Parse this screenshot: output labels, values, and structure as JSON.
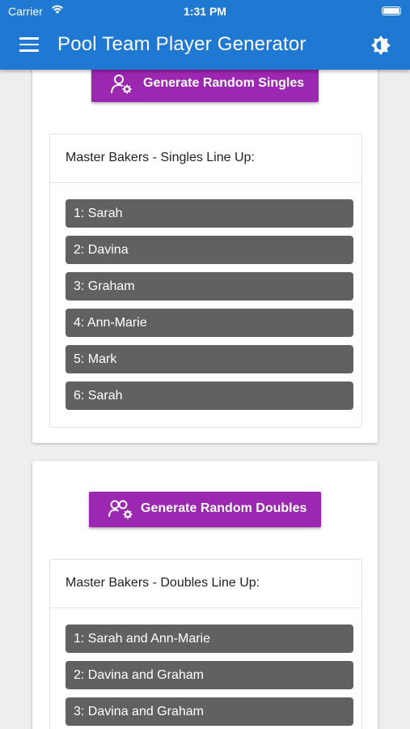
{
  "status": {
    "carrier": "Carrier",
    "time": "1:31 PM"
  },
  "appbar": {
    "title": "Pool Team Player Generator"
  },
  "singles": {
    "button_label": "Generate Random Singles",
    "panel_title": "Master Bakers - Singles Line Up:",
    "items": [
      "1: Sarah",
      "2: Davina",
      "3: Graham",
      "4: Ann-Marie",
      "5: Mark",
      "6: Sarah"
    ]
  },
  "doubles": {
    "button_label": "Generate Random Doubles",
    "panel_title": "Master Bakers - Doubles Line Up:",
    "items": [
      "1: Sarah and Ann-Marie",
      "2: Davina and Graham",
      "3: Davina and Graham"
    ]
  },
  "colors": {
    "appbar": "#1f79d2",
    "button": "#9c27b0",
    "list_item": "#616161"
  },
  "icons": {
    "menu": "hamburger-menu-icon",
    "theme": "brightness-icon",
    "singles": "user-gear-icon",
    "doubles": "users-gear-icon"
  }
}
